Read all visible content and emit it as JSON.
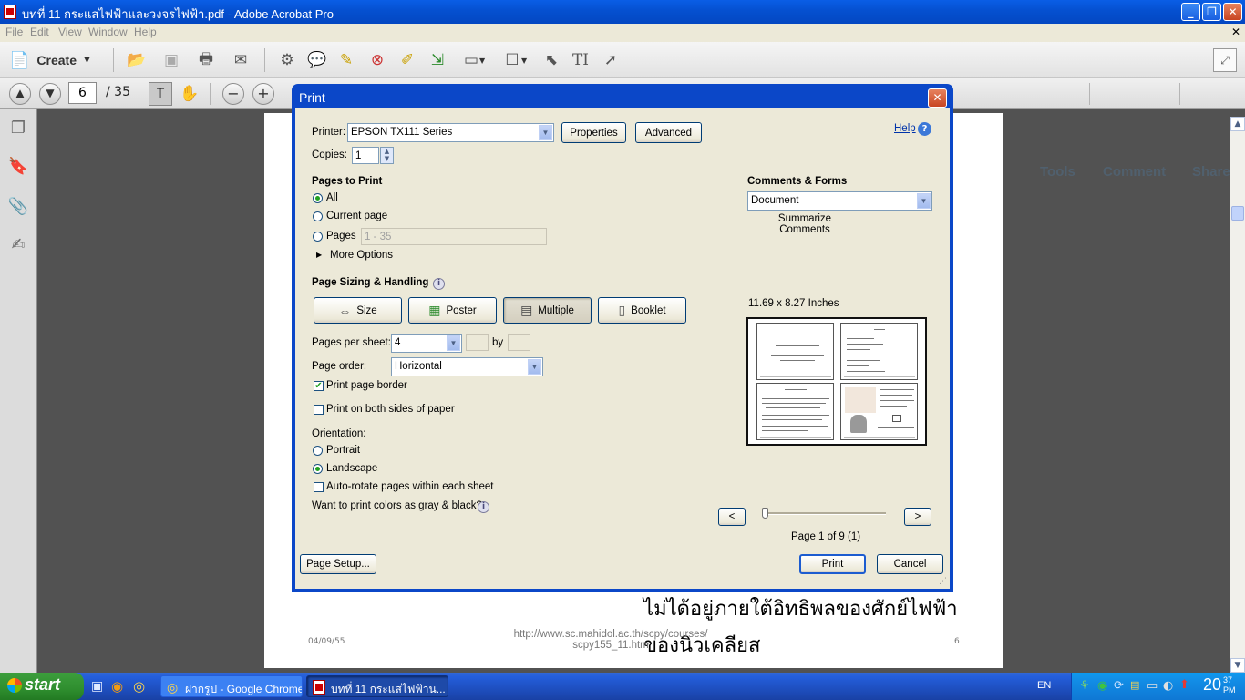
{
  "window": {
    "title": "บทที่ 11 กระแสไฟฟ้าและวงจรไฟฟ้า.pdf - Adobe Acrobat Pro"
  },
  "menu": [
    "File",
    "Edit",
    "View",
    "Window",
    "Help"
  ],
  "toolbar": {
    "create_label": "Create"
  },
  "nav": {
    "current_page": "6",
    "total_pages": "/ 35"
  },
  "right_links": [
    "Tools",
    "Comment",
    "Share"
  ],
  "document": {
    "thai_line1": "ไม่ได้อยู่ภายใต้อิทธิพลของศักย์ไฟฟ้า",
    "thai_line2": "ของนิวเคลียส",
    "date": "04/09/55",
    "url_line1": "http://www.sc.mahidol.ac.th/scpy/courses/",
    "url_line2": "scpy155_11.htm",
    "page_number": "6"
  },
  "print_dialog": {
    "title": "Print",
    "help_label": "Help",
    "printer_label": "Printer:",
    "printer_value": "EPSON TX111 Series",
    "properties_button": "Properties",
    "advanced_button": "Advanced",
    "copies_label": "Copies:",
    "copies_value": "1",
    "pages_to_print": {
      "heading": "Pages to Print",
      "all": "All",
      "current_page": "Current page",
      "pages": "Pages",
      "pages_placeholder": "1 - 35",
      "more_options": "More Options",
      "selected": "All"
    },
    "sizing": {
      "heading": "Page Sizing & Handling",
      "buttons": [
        "Size",
        "Poster",
        "Multiple",
        "Booklet"
      ],
      "active": "Multiple",
      "pages_per_sheet_label": "Pages per sheet:",
      "pages_per_sheet_value": "4",
      "by_label": "by",
      "page_order_label": "Page order:",
      "page_order_value": "Horizontal",
      "print_page_border": "Print page border",
      "print_page_border_checked": true,
      "print_both_sides": "Print on both sides of paper",
      "print_both_sides_checked": false
    },
    "orientation": {
      "label": "Orientation:",
      "portrait": "Portrait",
      "landscape": "Landscape",
      "selected": "Landscape",
      "auto_rotate": "Auto-rotate pages within each sheet",
      "auto_rotate_checked": false
    },
    "gray_question": "Want to print colors as gray & black?",
    "comments_forms": {
      "heading": "Comments & Forms",
      "value": "Document",
      "summarize": "Summarize Comments"
    },
    "preview": {
      "size_label": "11.69 x 8.27 Inches",
      "prev": "<",
      "next": ">",
      "page_status": "Page 1 of 9 (1)",
      "position_fraction": 0
    },
    "page_setup_button": "Page Setup...",
    "print_button": "Print",
    "cancel_button": "Cancel"
  },
  "taskbar": {
    "start_label": "start",
    "tasks": [
      {
        "label": "ฝากรูป - Google Chrome",
        "active": false
      },
      {
        "label": "บทที่ 11 กระแสไฟฟ้าน...",
        "active": true
      }
    ],
    "language": "EN",
    "clock": "20",
    "clock_minutes": "37",
    "clock_ampm": "PM"
  }
}
